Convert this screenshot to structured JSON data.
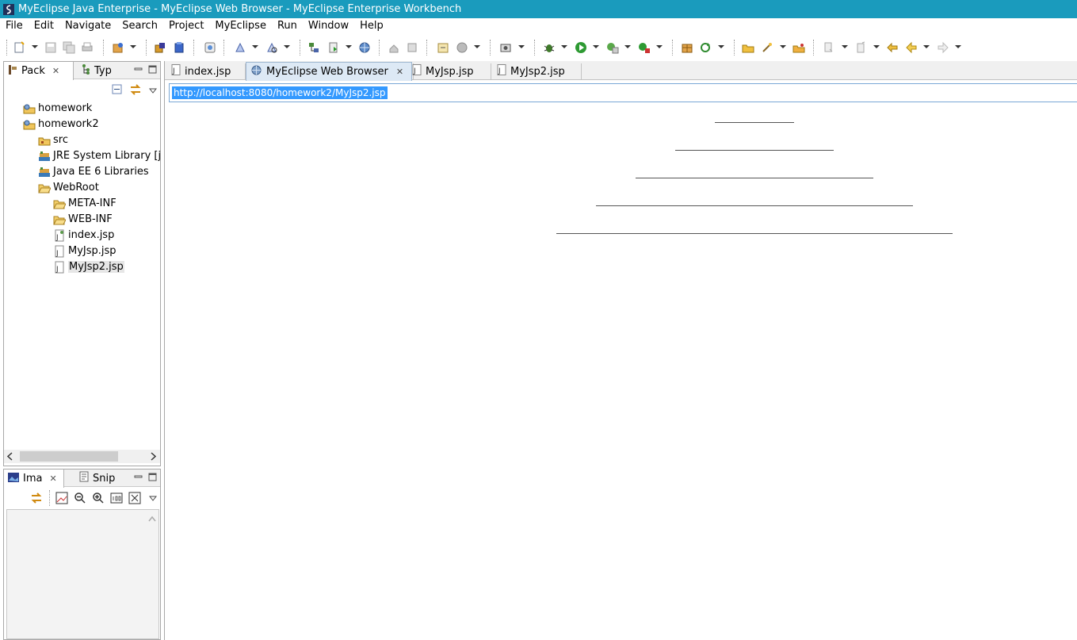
{
  "window": {
    "title": "MyEclipse Java Enterprise - MyEclipse Web Browser - MyEclipse Enterprise Workbench"
  },
  "menu": [
    "File",
    "Edit",
    "Navigate",
    "Search",
    "Project",
    "MyEclipse",
    "Run",
    "Window",
    "Help"
  ],
  "package_panel": {
    "tabs": [
      {
        "label": "Pack",
        "icon": "package-explorer-icon",
        "active": true
      },
      {
        "label": "Typ",
        "icon": "type-hierarchy-icon",
        "active": false
      }
    ],
    "tree": [
      {
        "label": "homework",
        "icon": "web-project-icon",
        "level": 0
      },
      {
        "label": "homework2",
        "icon": "web-project-icon",
        "level": 0
      },
      {
        "label": "src",
        "icon": "source-folder-icon",
        "level": 1
      },
      {
        "label": "JRE System Library [jdk",
        "icon": "library-icon",
        "level": 1
      },
      {
        "label": "Java EE 6 Libraries",
        "icon": "library-icon",
        "level": 1
      },
      {
        "label": "WebRoot",
        "icon": "folder-open-icon",
        "level": 1
      },
      {
        "label": "META-INF",
        "icon": "folder-icon",
        "level": 2
      },
      {
        "label": "WEB-INF",
        "icon": "folder-icon",
        "level": 2
      },
      {
        "label": "index.jsp",
        "icon": "jsp-file-icon",
        "level": 2
      },
      {
        "label": "MyJsp.jsp",
        "icon": "jsp-file-icon",
        "level": 2
      },
      {
        "label": "MyJsp2.jsp",
        "icon": "jsp-file-icon",
        "level": 2,
        "selected": true
      }
    ]
  },
  "image_panel": {
    "tabs": [
      {
        "label": "Ima",
        "icon": "image-viewer-icon",
        "active": true
      },
      {
        "label": "Snip",
        "icon": "snippets-icon",
        "active": false
      }
    ]
  },
  "editor": {
    "tabs": [
      {
        "label": "index.jsp",
        "icon": "jsp-file-icon",
        "active": false
      },
      {
        "label": "MyEclipse Web Browser",
        "icon": "globe-icon",
        "active": true
      },
      {
        "label": "MyJsp.jsp",
        "icon": "jsp-file-icon",
        "active": false
      },
      {
        "label": "MyJsp2.jsp",
        "icon": "jsp-file-icon",
        "active": false
      }
    ],
    "url": "http://localhost:8080/homework2/MyJsp2.jsp",
    "rendered_hr_count": 5
  },
  "colors": {
    "titlebar": "#1a9bbd",
    "selection": "#3399ff"
  }
}
